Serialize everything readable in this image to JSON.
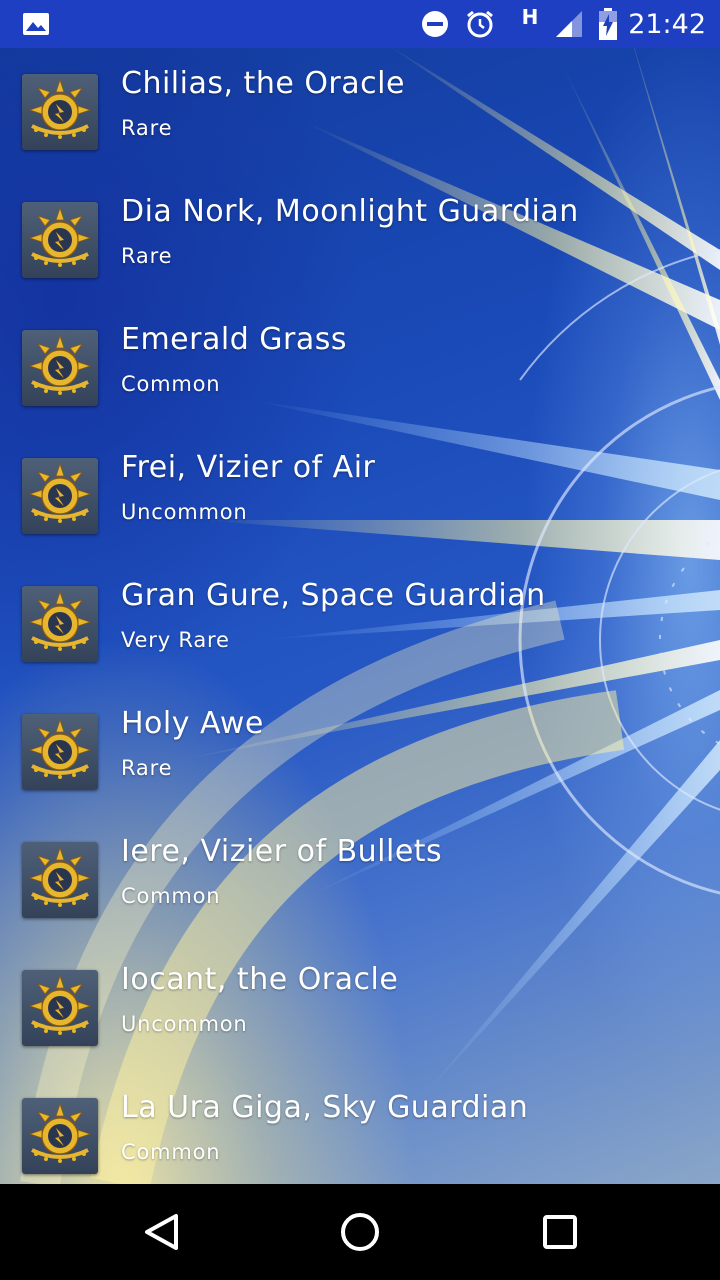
{
  "status_bar": {
    "time": "21:42",
    "network_type": "H",
    "icons": [
      "image-icon",
      "do-not-disturb-icon",
      "alarm-icon",
      "signal-icon",
      "battery-charging-icon"
    ]
  },
  "cards": [
    {
      "name": "Chilias, the Oracle",
      "rarity": "Rare"
    },
    {
      "name": "Dia Nork, Moonlight Guardian",
      "rarity": "Rare"
    },
    {
      "name": "Emerald Grass",
      "rarity": "Common"
    },
    {
      "name": "Frei, Vizier of Air",
      "rarity": "Uncommon"
    },
    {
      "name": "Gran Gure, Space Guardian",
      "rarity": "Very Rare"
    },
    {
      "name": "Holy Awe",
      "rarity": "Rare"
    },
    {
      "name": "Iere, Vizier of Bullets",
      "rarity": "Common"
    },
    {
      "name": "Iocant, the Oracle",
      "rarity": "Uncommon"
    },
    {
      "name": "La Ura Giga, Sky Guardian",
      "rarity": "Common"
    }
  ],
  "card_icon": "light-civilization-sun-icon",
  "nav_bar": {
    "icons": [
      "back-icon",
      "home-icon",
      "recents-icon"
    ]
  },
  "colors": {
    "status_bar": "#1e3fc2",
    "icon_gold": "#e8b62c",
    "text": "#ffffff",
    "nav_bar": "#000000"
  }
}
